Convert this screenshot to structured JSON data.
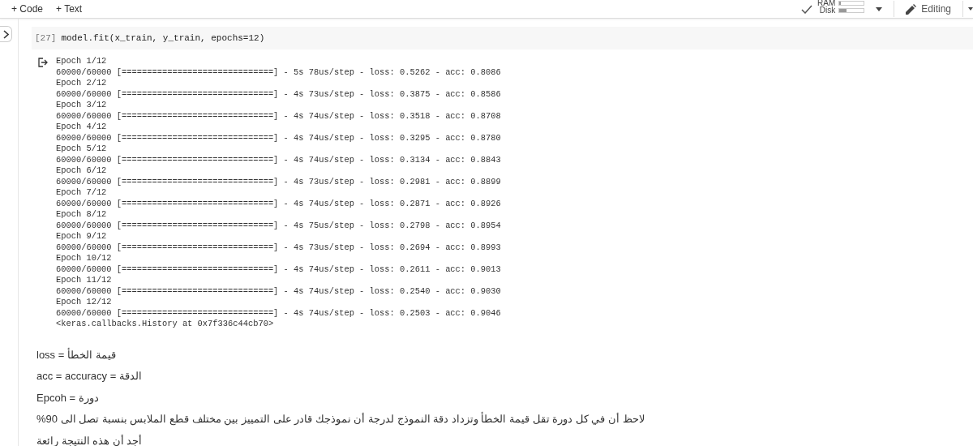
{
  "toolbar": {
    "buttons": [
      {
        "label": "+ Code"
      },
      {
        "label": "+ Text"
      }
    ],
    "meters": [
      {
        "label": "RAM",
        "level": 0.05
      },
      {
        "label": "Disk",
        "level": 0.3
      }
    ],
    "mode": "Editing"
  },
  "code_cell": {
    "execution_count": "[27]",
    "source": "model.fit(x_train, y_train, epochs=12)",
    "output": [
      {
        "header": "Epoch 1/12",
        "line": "60000/60000 [==============================] - 5s 78us/step - loss: 0.5262 - acc: 0.8086"
      },
      {
        "header": "Epoch 2/12",
        "line": "60000/60000 [==============================] - 4s 73us/step - loss: 0.3875 - acc: 0.8586"
      },
      {
        "header": "Epoch 3/12",
        "line": "60000/60000 [==============================] - 4s 74us/step - loss: 0.3518 - acc: 0.8708"
      },
      {
        "header": "Epoch 4/12",
        "line": "60000/60000 [==============================] - 4s 74us/step - loss: 0.3295 - acc: 0.8780"
      },
      {
        "header": "Epoch 5/12",
        "line": "60000/60000 [==============================] - 4s 74us/step - loss: 0.3134 - acc: 0.8843"
      },
      {
        "header": "Epoch 6/12",
        "line": "60000/60000 [==============================] - 4s 73us/step - loss: 0.2981 - acc: 0.8899"
      },
      {
        "header": "Epoch 7/12",
        "line": "60000/60000 [==============================] - 4s 74us/step - loss: 0.2871 - acc: 0.8926"
      },
      {
        "header": "Epoch 8/12",
        "line": "60000/60000 [==============================] - 4s 75us/step - loss: 0.2798 - acc: 0.8954"
      },
      {
        "header": "Epoch 9/12",
        "line": "60000/60000 [==============================] - 4s 73us/step - loss: 0.2694 - acc: 0.8993"
      },
      {
        "header": "Epoch 10/12",
        "line": "60000/60000 [==============================] - 4s 74us/step - loss: 0.2611 - acc: 0.9013"
      },
      {
        "header": "Epoch 11/12",
        "line": "60000/60000 [==============================] - 4s 74us/step - loss: 0.2540 - acc: 0.9030"
      },
      {
        "header": "Epoch 12/12",
        "line": "60000/60000 [==============================] - 4s 74us/step - loss: 0.2503 - acc: 0.9046"
      }
    ],
    "result": "<keras.callbacks.History at 0x7f336c44cb70>"
  },
  "text_cells": [
    {
      "kind": "ltr",
      "text": "loss = قيمة الخطأ"
    },
    {
      "kind": "ltr",
      "text": "acc = accuracy = الدقة"
    },
    {
      "kind": "ltr",
      "text": "Epcoh = دورة"
    },
    {
      "kind": "rtl",
      "text": "لاحظ أن في كل دورة تقل قيمة الخطأ وتزداد دقة النموذج لدرجة أن نموذجك قادر على التمييز بين مختلف قطع الملابس بنسبة تصل الى 90%"
    },
    {
      "kind": "rtl",
      "text": "أجد أن هذه النتيجة رائعة"
    }
  ]
}
